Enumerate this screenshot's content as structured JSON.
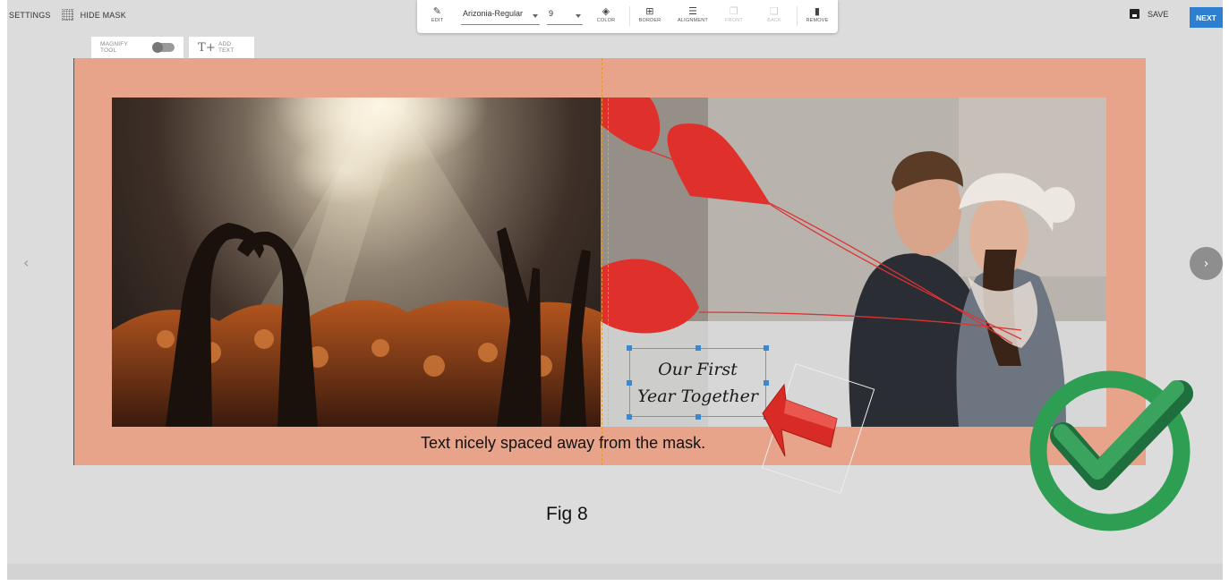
{
  "menu": {
    "settings_label": "SETTINGS",
    "hide_mask_label": "HIDE MASK"
  },
  "toolbar": {
    "edit_label": "EDIT",
    "font_value": "Arizonia-Regular",
    "size_value": "9",
    "color_label": "COLOR",
    "border_label": "BORDER",
    "alignment_label": "ALIGNMENT",
    "front_label": "FRONT",
    "back_label": "BACK",
    "remove_label": "REMOVE"
  },
  "actions": {
    "save_label": "SAVE",
    "next_label": "NEXT"
  },
  "tools": {
    "magnify_label": "MAGNIFY TOOL",
    "magnify_on": false,
    "add_text_label": "ADD TEXT"
  },
  "canvas": {
    "mask_color": "#e8a48a",
    "text_box_line1": "Our First",
    "text_box_line2": "Year Together",
    "caption": "Text nicely spaced away from the mask."
  },
  "figure_label": "Fig 8",
  "colors": {
    "accent": "#2f7fd1",
    "selection": "#3b87d4",
    "check_green": "#2e9e52"
  }
}
